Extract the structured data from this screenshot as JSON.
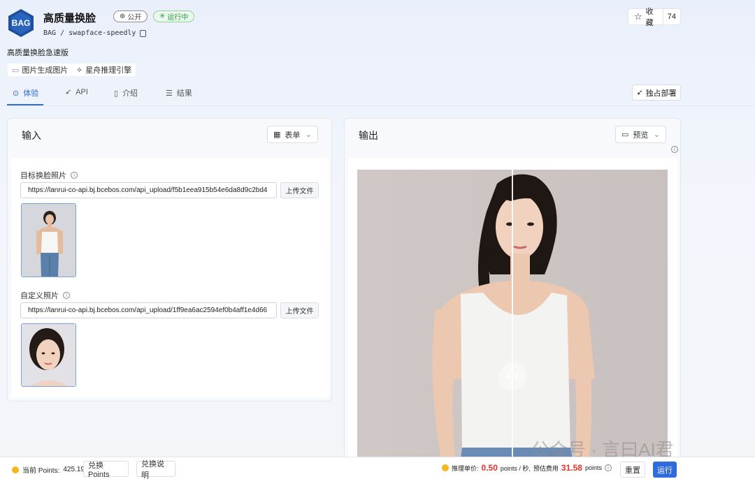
{
  "header": {
    "logo_text": "BAG",
    "title": "高质量换脸",
    "public_badge": "公开",
    "running_badge": "运行中",
    "repo": "BAG / swapface-speedly",
    "star_label": "收藏",
    "star_count": "74",
    "subtitle": "高质量换脸急速版",
    "tags": [
      "图片生成图片",
      "星舟推理引擎"
    ]
  },
  "tabs": [
    {
      "label": "体验",
      "icon": "play-icon",
      "active": true
    },
    {
      "label": "API",
      "icon": "rocket-icon"
    },
    {
      "label": "介绍",
      "icon": "book-icon"
    },
    {
      "label": "结果",
      "icon": "table-icon"
    }
  ],
  "deploy_label": "独占部署",
  "input_panel": {
    "title": "输入",
    "mode": "表单",
    "fields": [
      {
        "label": "目标换脸照片",
        "value": "https://lanrui-co-api.bj.bcebos.com/api_upload/f5b1eea915b54e6da8d9c2bd4",
        "upload_label": "上传文件"
      },
      {
        "label": "自定义照片",
        "value": "https://lanrui-co-api.bj.bcebos.com/api_upload/1ff9ea6ac2594ef0b4aff1e4d66",
        "upload_label": "上传文件"
      }
    ]
  },
  "output_panel": {
    "title": "输出",
    "mode": "预览"
  },
  "bottom": {
    "points_label": "当前 Points:",
    "points_value": "425.19",
    "redeem_label": "兑换 Points",
    "redeem_help": "兑换说明",
    "price_label": "推理单价:",
    "price_value": "0.50",
    "price_unit": "points / 秒,",
    "est_label": "预估费用",
    "est_value": "31.58",
    "est_unit": "points",
    "reset_label": "重置",
    "run_label": "运行"
  },
  "watermark": "公众号 · 言曰AI君",
  "colors": {
    "accent": "#2f6bdc",
    "running": "#2b9a46",
    "price": "#e0342b",
    "coin": "#f5b81c"
  }
}
